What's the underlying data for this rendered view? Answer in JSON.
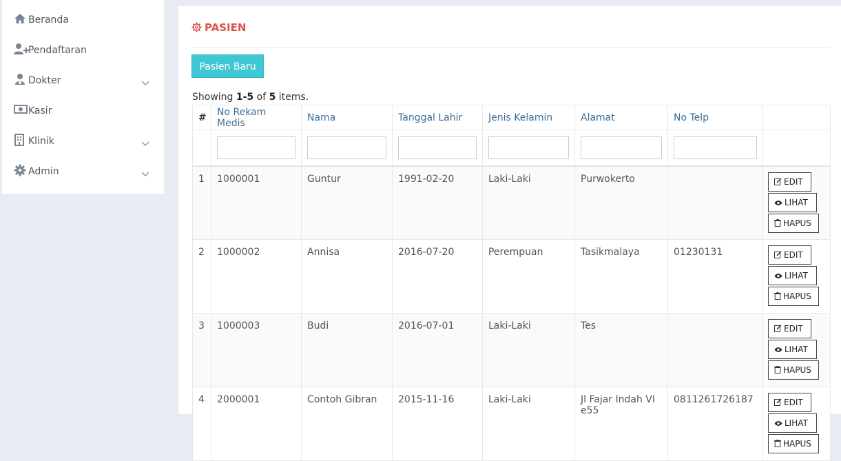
{
  "sidebar": {
    "items": [
      {
        "label": "Beranda",
        "icon": "home-icon",
        "has_submenu": false
      },
      {
        "label": "Pendaftaran",
        "icon": "user-plus-icon",
        "has_submenu": false
      },
      {
        "label": "Dokter",
        "icon": "user-md-icon",
        "has_submenu": true
      },
      {
        "label": "Kasir",
        "icon": "money-icon",
        "has_submenu": false
      },
      {
        "label": "Klinik",
        "icon": "building-icon",
        "has_submenu": true
      },
      {
        "label": "Admin",
        "icon": "gear-icon",
        "has_submenu": true
      }
    ]
  },
  "main": {
    "title": "PASIEN",
    "title_icon": "gear-icon",
    "new_button": "Pasien Baru",
    "summary": {
      "prefix": "Showing ",
      "range": "1-5",
      "mid": " of ",
      "total": "5",
      "suffix": " items."
    },
    "table": {
      "columns": [
        "#",
        "No Rekam Medis",
        "Nama",
        "Tanggal Lahir",
        "Jenis Kelamin",
        "Alamat",
        "No Telp",
        ""
      ],
      "action_labels": {
        "edit": "EDIT",
        "view": "LIHAT",
        "delete": "HAPUS"
      },
      "rows": [
        {
          "no": "1",
          "rm": "1000001",
          "nama": "Guntur",
          "tgl": "1991-02-20",
          "jk": "Laki-Laki",
          "alamat": "Purwokerto",
          "telp": ""
        },
        {
          "no": "2",
          "rm": "1000002",
          "nama": "Annisa",
          "tgl": "2016-07-20",
          "jk": "Perempuan",
          "alamat": "Tasikmalaya",
          "telp": "01230131"
        },
        {
          "no": "3",
          "rm": "1000003",
          "nama": "Budi",
          "tgl": "2016-07-01",
          "jk": "Laki-Laki",
          "alamat": "Tes",
          "telp": ""
        },
        {
          "no": "4",
          "rm": "2000001",
          "nama": "Contoh Gibran",
          "tgl": "2015-11-16",
          "jk": "Laki-Laki",
          "alamat": "Jl Fajar Indah VI e55",
          "telp": "0811261726187"
        }
      ]
    }
  },
  "colors": {
    "title": "#d9534f",
    "button": "#3fc7d4",
    "header_link": "#3c6e99"
  }
}
